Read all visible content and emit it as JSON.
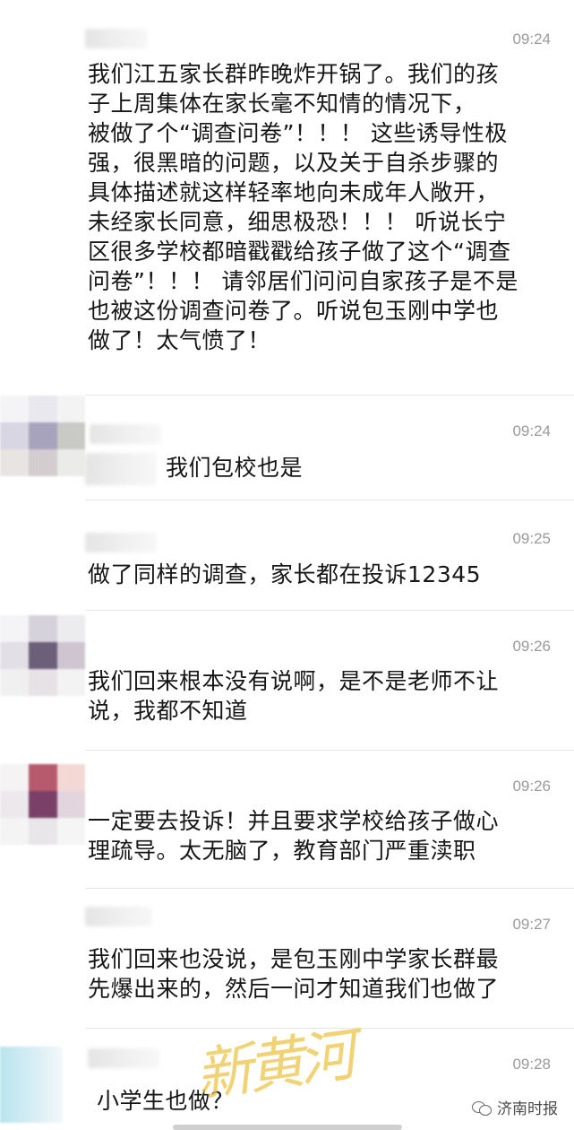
{
  "messages": [
    {
      "time": "09:24",
      "text": "我们江五家长群昨晚炸开锅了。我们的孩\n子上周集体在家长毫不知情的情况下，\n被做了个“调查问卷”！！！ 这些诱导性极\n强，很黑暗的问题，以及关于自杀步骤的\n具体描述就这样轻率地向未成年人敞开，\n未经家长同意，细思极恐！！！ 听说长宁\n区很多学校都暗戳戳给孩子做了这个“调查\n问卷”！！！ 请邻居们问问自家孩子是不是\n也被这份调查问卷了。听说包玉刚中学也\n做了！太气愤了！"
    },
    {
      "time": "09:24",
      "text": "我们包校也是"
    },
    {
      "time": "09:25",
      "text": "做了同样的调查，家长都在投诉12345"
    },
    {
      "time": "09:26",
      "text": "我们回来根本没有说啊，是不是老师不让\n说，我都不知道"
    },
    {
      "time": "09:26",
      "text": "一定要去投诉！并且要求学校给孩子做心\n理疏导。太无脑了，教育部门严重渎职"
    },
    {
      "time": "09:27",
      "text": "我们回来也没说，是包玉刚中学家长群最\n先爆出来的，然后一问才知道我们也做了"
    },
    {
      "time": "09:28",
      "text": "小学生也做？"
    }
  ],
  "watermark": "新黄河",
  "brand": "济南时报"
}
